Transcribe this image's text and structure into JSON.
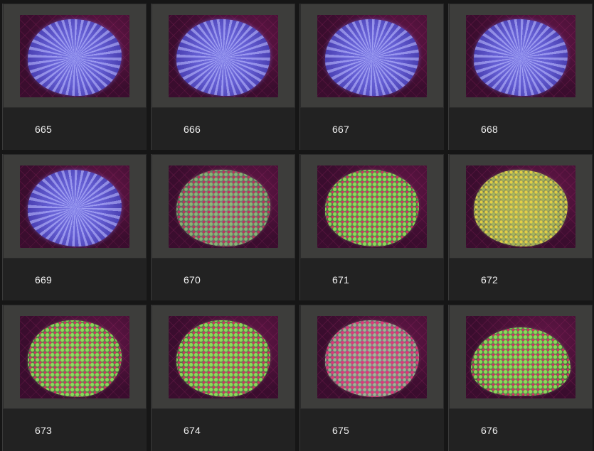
{
  "gallery": {
    "items": [
      {
        "number": "665",
        "style": "tentacle"
      },
      {
        "number": "666",
        "style": "tentacle"
      },
      {
        "number": "667",
        "style": "tentacle"
      },
      {
        "number": "668",
        "style": "tentacle"
      },
      {
        "number": "669",
        "style": "tentacle"
      },
      {
        "number": "670",
        "style": "polyp"
      },
      {
        "number": "671",
        "style": "polyp green"
      },
      {
        "number": "672",
        "style": "polyp yellow"
      },
      {
        "number": "673",
        "style": "polyp green"
      },
      {
        "number": "674",
        "style": "polyp green"
      },
      {
        "number": "675",
        "style": "polyp pink"
      },
      {
        "number": "676",
        "style": "polyp green sparse"
      }
    ]
  },
  "colors": {
    "page_background": "#161616",
    "cell_background": "#222222",
    "frame_background": "#3d3d3b",
    "caption_text": "#f2f2f2"
  }
}
